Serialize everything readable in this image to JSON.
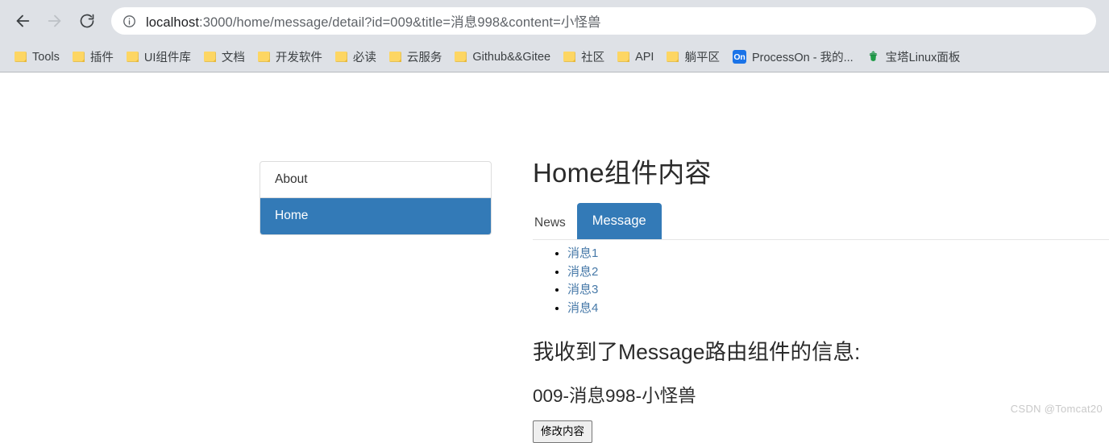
{
  "browser": {
    "nav": {
      "back_icon": "arrow-left-icon",
      "forward_icon": "arrow-right-icon",
      "reload_icon": "reload-icon"
    },
    "omnibox": {
      "info_icon": "info-circle-icon",
      "host": "localhost",
      "path": ":3000/home/message/detail?id=009&title=消息998&content=小怪兽",
      "full_url": "localhost:3000/home/message/detail?id=009&title=消息998&content=小怪兽"
    },
    "bookmarks": [
      {
        "label": "Tools",
        "icon": "folder-icon"
      },
      {
        "label": "插件",
        "icon": "folder-icon"
      },
      {
        "label": "UI组件库",
        "icon": "folder-icon"
      },
      {
        "label": "文档",
        "icon": "folder-icon"
      },
      {
        "label": "开发软件",
        "icon": "folder-icon"
      },
      {
        "label": "必读",
        "icon": "folder-icon"
      },
      {
        "label": "云服务",
        "icon": "folder-icon"
      },
      {
        "label": "Github&&Gitee",
        "icon": "folder-icon"
      },
      {
        "label": "社区",
        "icon": "folder-icon"
      },
      {
        "label": "API",
        "icon": "folder-icon"
      },
      {
        "label": "躺平区",
        "icon": "folder-icon"
      },
      {
        "label": "ProcessOn - 我的...",
        "icon": "processon-icon"
      },
      {
        "label": "宝塔Linux面板",
        "icon": "pagoda-icon"
      }
    ]
  },
  "sidebar": {
    "items": [
      {
        "label": "About",
        "active": false
      },
      {
        "label": "Home",
        "active": true
      }
    ]
  },
  "main": {
    "title": "Home组件内容",
    "tabs": [
      {
        "label": "News",
        "active": false
      },
      {
        "label": "Message",
        "active": true
      }
    ],
    "messages": [
      {
        "label": "消息1"
      },
      {
        "label": "消息2"
      },
      {
        "label": "消息3"
      },
      {
        "label": "消息4"
      }
    ],
    "received_title": "我收到了Message路由组件的信息:",
    "received_value": "009-消息998-小怪兽",
    "edit_button": "修改内容"
  },
  "watermark": "CSDN @Tomcat20",
  "colors": {
    "primary": "#337ab7",
    "chrome_bg": "#dee1e6",
    "link": "#4779a8",
    "bookmark_folder": "#fdd663"
  }
}
